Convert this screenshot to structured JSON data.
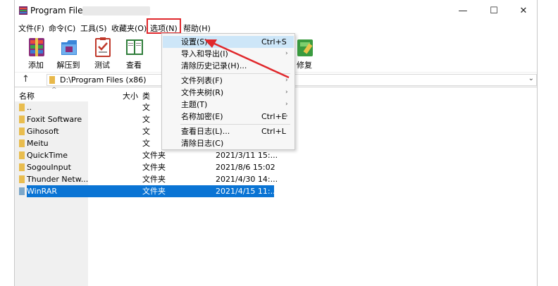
{
  "window": {
    "title": "Program Files",
    "min": "—",
    "max": "☐",
    "close": "✕"
  },
  "menubar": [
    {
      "label": "文件(F)"
    },
    {
      "label": "命令(C)"
    },
    {
      "label": "工具(S)"
    },
    {
      "label": "收藏夹(O)"
    },
    {
      "label": "选项(N)"
    },
    {
      "label": "帮助(H)"
    }
  ],
  "toolbar": [
    {
      "label": "添加",
      "icon": "add-archive-icon"
    },
    {
      "label": "解压到",
      "icon": "extract-folder-icon"
    },
    {
      "label": "测试",
      "icon": "test-clipboard-icon"
    },
    {
      "label": "查看",
      "icon": "view-book-icon"
    },
    {
      "label": "修复",
      "icon": "repair-first-aid-icon"
    }
  ],
  "address": {
    "path": "D:\\Program Files (x86)"
  },
  "columns": {
    "name": "名称",
    "size": "大小",
    "type": "类"
  },
  "files": [
    {
      "name": "..",
      "type": "文",
      "date": ""
    },
    {
      "name": "Foxit Software",
      "type": "文",
      "date": ""
    },
    {
      "name": "Gihosoft",
      "type": "文",
      "date": ""
    },
    {
      "name": "Meitu",
      "type": "文",
      "date": ""
    },
    {
      "name": "QuickTime",
      "type": "文件夹",
      "date": "2021/3/11 15:..."
    },
    {
      "name": "SogouInput",
      "type": "文件夹",
      "date": "2021/8/6 15:02"
    },
    {
      "name": "Thunder Netw...",
      "type": "文件夹",
      "date": "2021/4/30 14:..."
    },
    {
      "name": "WinRAR",
      "type": "文件夹",
      "date": "2021/4/15 11:..."
    }
  ],
  "options_menu": [
    {
      "label": "设置(S)...",
      "shortcut": "Ctrl+S",
      "submenu": false
    },
    {
      "label": "导入和导出(I)",
      "shortcut": "",
      "submenu": true
    },
    {
      "label": "清除历史记录(H)...",
      "shortcut": "",
      "submenu": false
    },
    {
      "label": "文件列表(F)",
      "shortcut": "",
      "submenu": true
    },
    {
      "label": "文件夹树(R)",
      "shortcut": "",
      "submenu": true
    },
    {
      "label": "主题(T)",
      "shortcut": "",
      "submenu": true
    },
    {
      "label": "名称加密(E)",
      "shortcut": "Ctrl+E",
      "submenu": true
    },
    {
      "label": "查看日志(L)...",
      "shortcut": "Ctrl+L",
      "submenu": false
    },
    {
      "label": "清除日志(C)",
      "shortcut": "",
      "submenu": false
    }
  ],
  "colors": {
    "highlight_box": "#e0282c",
    "selection": "#0a74d4",
    "menu_hover": "#cde6f8",
    "annotation_arrow": "#e0282c"
  }
}
